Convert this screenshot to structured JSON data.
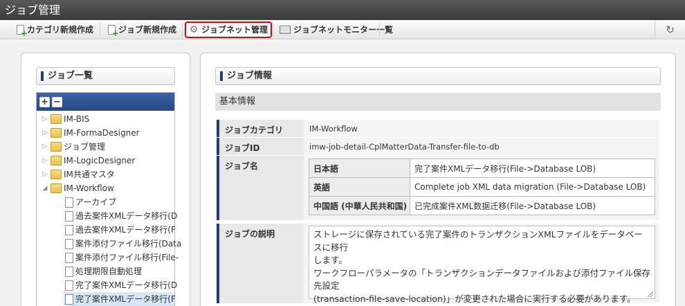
{
  "app": {
    "title": "ジョブ管理"
  },
  "toolbar": {
    "buttons": [
      {
        "label": "カテゴリ新規作成",
        "icon": "new-document-icon"
      },
      {
        "label": "ジョブ新規作成",
        "icon": "new-document-icon"
      },
      {
        "label": "ジョブネット管理",
        "icon": "gear-icon",
        "highlighted": true
      },
      {
        "label": "ジョブネットモニター一覧",
        "icon": "list-icon"
      }
    ],
    "refresh_icon": "↻",
    "refresh_symbol": "refresh-icon"
  },
  "left_panel": {
    "title": "ジョブ一覧",
    "expand_symbol": "+",
    "collapse_symbol": "−",
    "tree": [
      {
        "label": "IM-BIS",
        "type": "folder",
        "expanded": false,
        "level": 0
      },
      {
        "label": "IM-FormaDesigner",
        "type": "folder",
        "expanded": false,
        "level": 0
      },
      {
        "label": "ジョブ管理",
        "type": "folder",
        "expanded": false,
        "level": 0
      },
      {
        "label": "IM-LogicDesigner",
        "type": "folder",
        "expanded": false,
        "level": 0
      },
      {
        "label": "IM共通マスタ",
        "type": "folder",
        "expanded": false,
        "level": 0
      },
      {
        "label": "IM-Workflow",
        "type": "folder",
        "expanded": true,
        "level": 0
      },
      {
        "label": "アーカイブ",
        "type": "job",
        "level": 1
      },
      {
        "label": "過去案件XMLデータ移行(D",
        "type": "job",
        "level": 1
      },
      {
        "label": "過去案件XMLデータ移行(F",
        "type": "job",
        "level": 1
      },
      {
        "label": "案件添付ファイル移行(Data",
        "type": "job",
        "level": 1
      },
      {
        "label": "案件添付ファイル移行(File-",
        "type": "job",
        "level": 1
      },
      {
        "label": "処理期限自動処理",
        "type": "job",
        "level": 1
      },
      {
        "label": "完了案件XMLデータ移行(D",
        "type": "job",
        "level": 1
      },
      {
        "label": "完了案件XMLデータ移行(F",
        "type": "job",
        "level": 1,
        "selected": true
      }
    ]
  },
  "right_panel": {
    "title": "ジョブ情報",
    "section": "基本情報",
    "fields": {
      "category": {
        "label": "ジョブカテゴリ",
        "value": "IM-Workflow"
      },
      "id": {
        "label": "ジョブID",
        "value": "imw-job-detail-CplMatterData-Transfer-file-to-db"
      },
      "name": {
        "label": "ジョブ名",
        "locales": [
          {
            "lang": "日本語",
            "value": "完了案件XMLデータ移行(File->Database LOB)"
          },
          {
            "lang": "英語",
            "value": "Complete job XML data migration (File->Database LOB)"
          },
          {
            "lang": "中国語 (中華人民共和国)",
            "value": "已完成案件XML数据迁移(File->Database LOB)"
          }
        ]
      },
      "description": {
        "label": "ジョブの説明",
        "lines": [
          "ストレージに保存されている完了案件のトランザクションXMLファイルをデータベースに移行",
          "します。",
          "ワークフローパラメータの「トランザクションデータファイルおよび添付ファイル保存先設定",
          "(transaction-file-save-location)」が変更された場合に実行する必要があります。"
        ]
      }
    }
  }
}
